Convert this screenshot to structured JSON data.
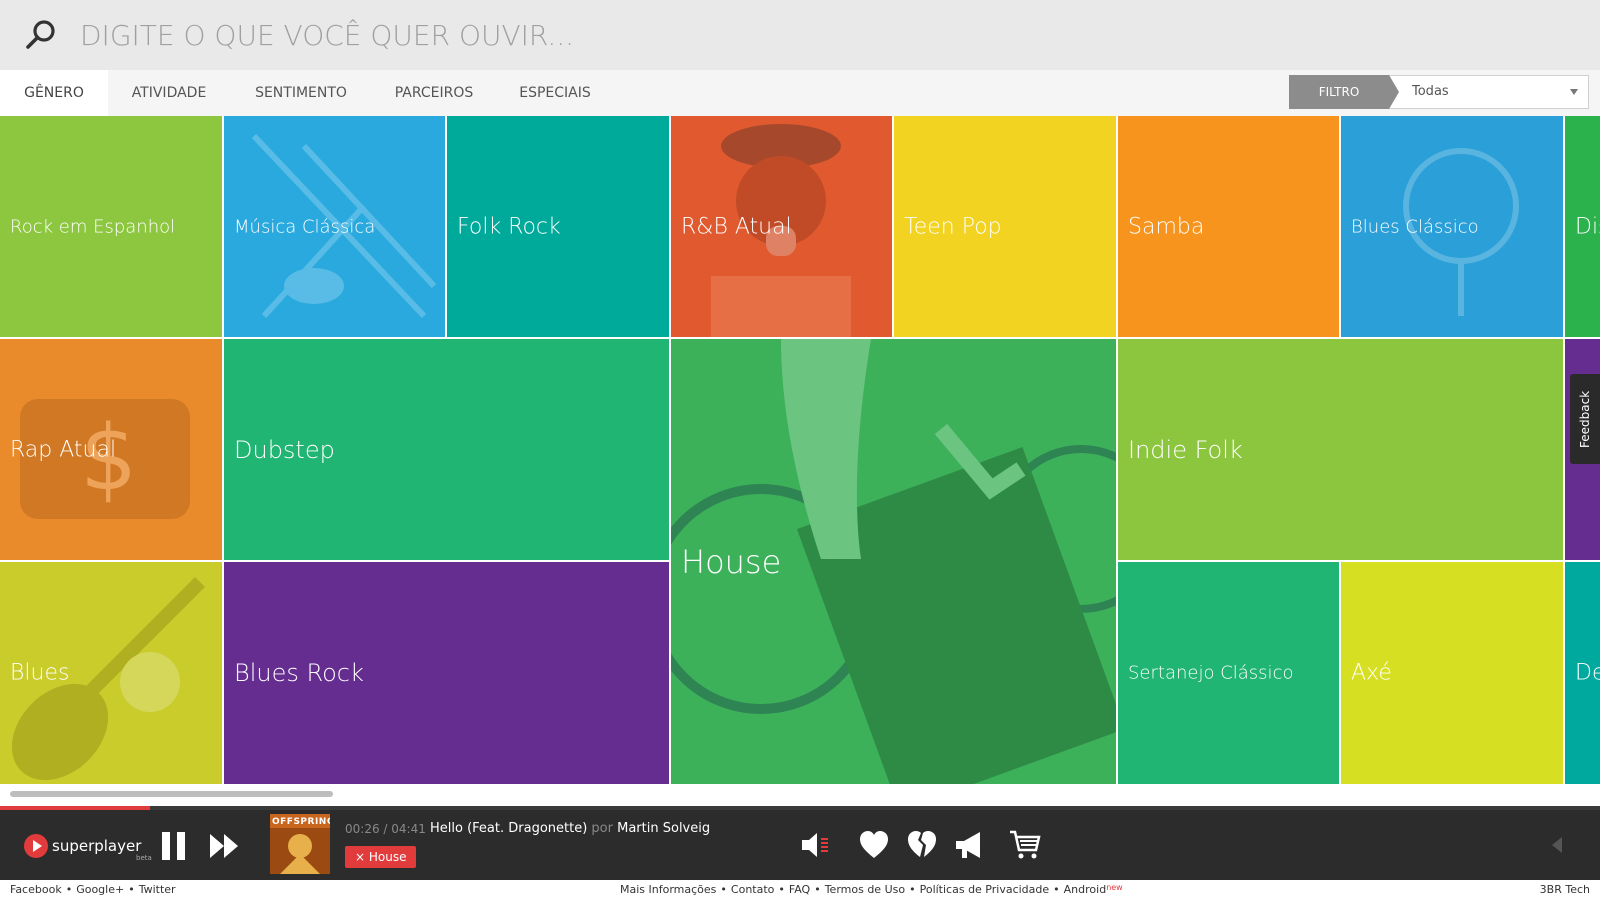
{
  "search": {
    "placeholder": "DIGITE O QUE VOCÊ QUER OUVIR..."
  },
  "tabs": [
    {
      "label": "GÊNERO",
      "active": true
    },
    {
      "label": "ATIVIDADE"
    },
    {
      "label": "SENTIMENTO"
    },
    {
      "label": "PARCEIROS"
    },
    {
      "label": "ESPECIAIS"
    }
  ],
  "filter": {
    "label": "FILTRO",
    "value": "Todas"
  },
  "tiles": [
    {
      "label": "Rock em Espanhol",
      "color": "#8dc63f"
    },
    {
      "label": "Música Clássica",
      "color": "#2aa9df"
    },
    {
      "label": "Folk Rock",
      "color": "#00aa9b"
    },
    {
      "label": "R&B Atual",
      "color": "#e15a2f"
    },
    {
      "label": "Teen Pop",
      "color": "#f2d321"
    },
    {
      "label": "Samba",
      "color": "#f7941d"
    },
    {
      "label": "Blues Clássico",
      "color": "#2a9fd8"
    },
    {
      "label": "Dis",
      "color": "#2bb24c"
    },
    {
      "label": "Rap Atual",
      "color": "#e98a2b"
    },
    {
      "label": "Dubstep",
      "color": "#21b573"
    },
    {
      "label": "House",
      "color": "#3cb15a"
    },
    {
      "label": "Indie Folk",
      "color": "#8cc63f"
    },
    {
      "label": "",
      "color": "#662d91"
    },
    {
      "label": "Blues",
      "color": "#c9cc2b"
    },
    {
      "label": "Blues Rock",
      "color": "#652d90"
    },
    {
      "label": "Sertanejo Clássico",
      "color": "#21b573"
    },
    {
      "label": "Axé",
      "color": "#d7df23"
    },
    {
      "label": "De",
      "color": "#00a99d"
    }
  ],
  "feedback": {
    "label": "Feedback"
  },
  "player": {
    "logo": "superplayer",
    "logo_badge": "beta",
    "cover_text": "OFFSPRING",
    "time": "00:26 / 04:41",
    "track_title": "Hello (Feat. Dragonette)",
    "track_by": "por",
    "track_artist": "Martin Solveig",
    "station_chip": "House",
    "progress": 0.094,
    "accent": "#e23b3b"
  },
  "footer": {
    "left": [
      "Facebook",
      "Google+",
      "Twitter"
    ],
    "center": [
      "Mais Informações",
      "Contato",
      "FAQ",
      "Termos de Uso",
      "Políticas de Privacidade",
      "Android"
    ],
    "android_badge": "new",
    "right": "3BR Tech"
  }
}
